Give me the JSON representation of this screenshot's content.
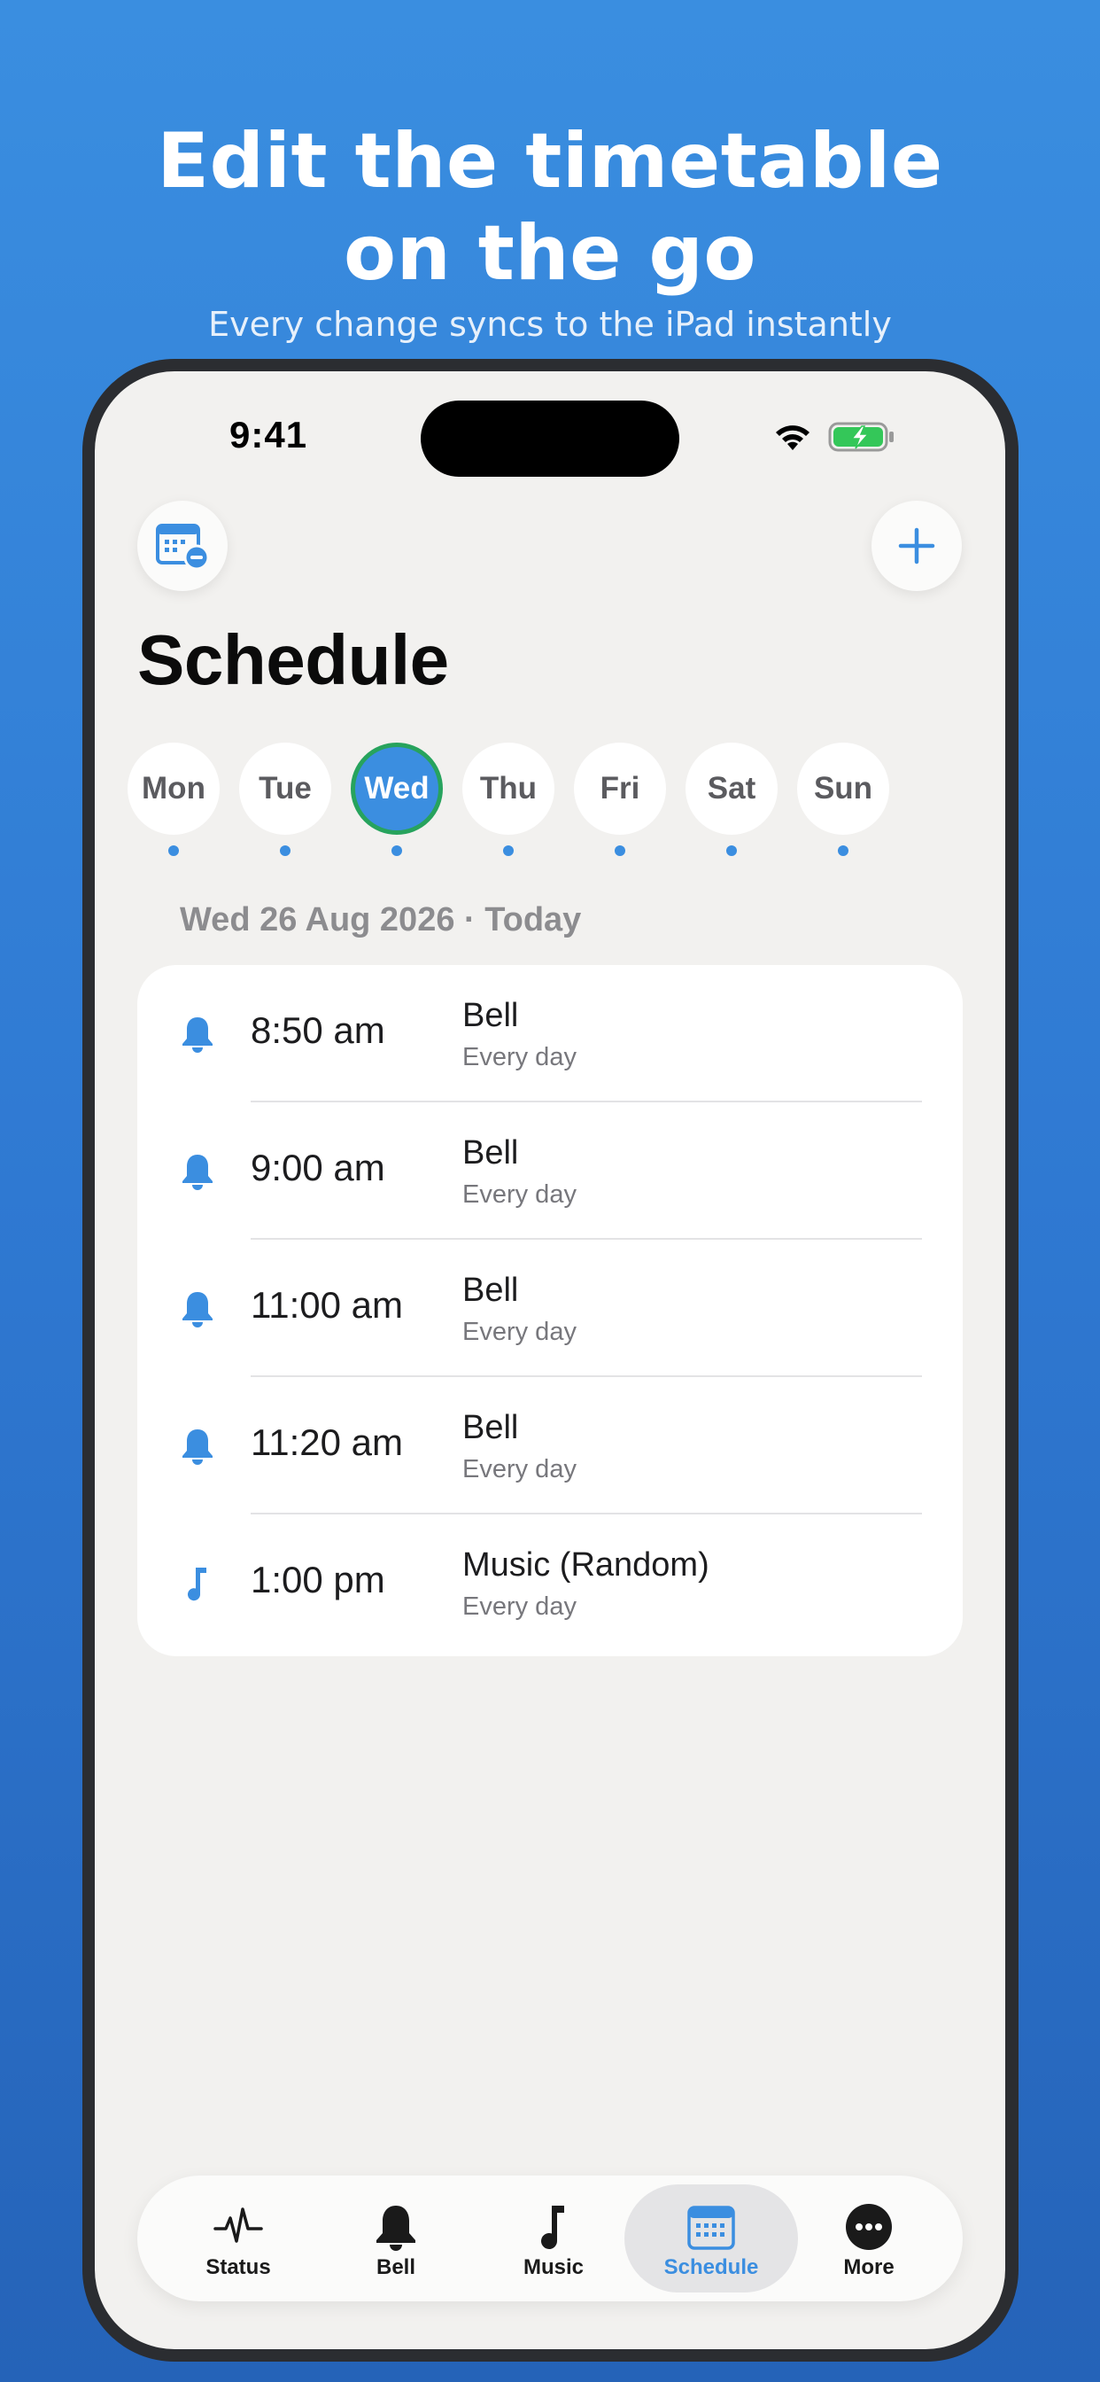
{
  "promo": {
    "title_line1": "Edit the timetable",
    "title_line2": "on the go",
    "subtitle": "Every change syncs to the iPad instantly"
  },
  "status_bar": {
    "time": "9:41",
    "icons": [
      "wifi-icon",
      "battery-charging-icon"
    ]
  },
  "toolbar": {
    "left_icon": "calendar-minus-icon",
    "right_icon": "plus-icon"
  },
  "page": {
    "title": "Schedule"
  },
  "days": [
    {
      "label": "Mon",
      "selected": false,
      "has_events": true
    },
    {
      "label": "Tue",
      "selected": false,
      "has_events": true
    },
    {
      "label": "Wed",
      "selected": true,
      "has_events": true
    },
    {
      "label": "Thu",
      "selected": false,
      "has_events": true
    },
    {
      "label": "Fri",
      "selected": false,
      "has_events": true
    },
    {
      "label": "Sat",
      "selected": false,
      "has_events": true
    },
    {
      "label": "Sun",
      "selected": false,
      "has_events": true
    }
  ],
  "date_header": "Wed 26 Aug 2026 · Today",
  "events": [
    {
      "icon": "bell-icon",
      "time": "8:50 am",
      "title": "Bell",
      "repeat": "Every day"
    },
    {
      "icon": "bell-icon",
      "time": "9:00 am",
      "title": "Bell",
      "repeat": "Every day"
    },
    {
      "icon": "bell-icon",
      "time": "11:00 am",
      "title": "Bell",
      "repeat": "Every day"
    },
    {
      "icon": "bell-icon",
      "time": "11:20 am",
      "title": "Bell",
      "repeat": "Every day"
    },
    {
      "icon": "music-note-icon",
      "time": "1:00 pm",
      "title": "Music (Random)",
      "repeat": "Every day"
    }
  ],
  "tabs": [
    {
      "label": "Status",
      "icon": "waveform-icon",
      "active": false
    },
    {
      "label": "Bell",
      "icon": "bell-icon",
      "active": false
    },
    {
      "label": "Music",
      "icon": "music-note-icon",
      "active": false
    },
    {
      "label": "Schedule",
      "icon": "calendar-icon",
      "active": true
    },
    {
      "label": "More",
      "icon": "more-icon",
      "active": false
    }
  ],
  "colors": {
    "accent": "#3b8ee0",
    "selected_ring": "#27a35d",
    "background_top": "#3a8ee0",
    "background_bottom": "#2563b8",
    "battery_green": "#34c759"
  }
}
